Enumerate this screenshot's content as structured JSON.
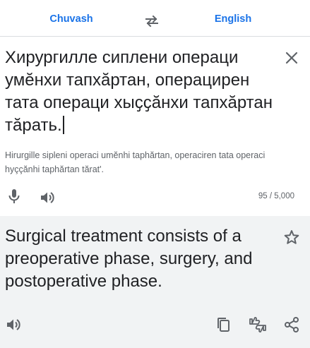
{
  "languages": {
    "source": "Chuvash",
    "target": "English"
  },
  "source": {
    "text": "Хирургилле сиплени операци умӗнхи тапхӑртан, операцирен тата операци хыҫҫӑнхи тапхӑртан тӑрать.",
    "transliteration": "Hirurgille sipleni operaci umĕnhi taphărtan, operaciren tata operaci hyççănhi taphărtan tărat'.",
    "char_count": "95 / 5,000"
  },
  "target": {
    "text": "Surgical treatment consists of a preoperative phase, surgery, and postoperative phase."
  },
  "icons": {
    "swap": "swap-horiz-icon",
    "clear": "close-icon",
    "mic": "mic-icon",
    "speaker": "volume-icon",
    "star": "star-outline-icon",
    "copy": "copy-icon",
    "feedback": "thumbs-feedback-icon",
    "share": "share-icon"
  },
  "colors": {
    "accent": "#1a73e8",
    "icon": "#5f6368",
    "translation_bg": "#f1f3f4"
  }
}
